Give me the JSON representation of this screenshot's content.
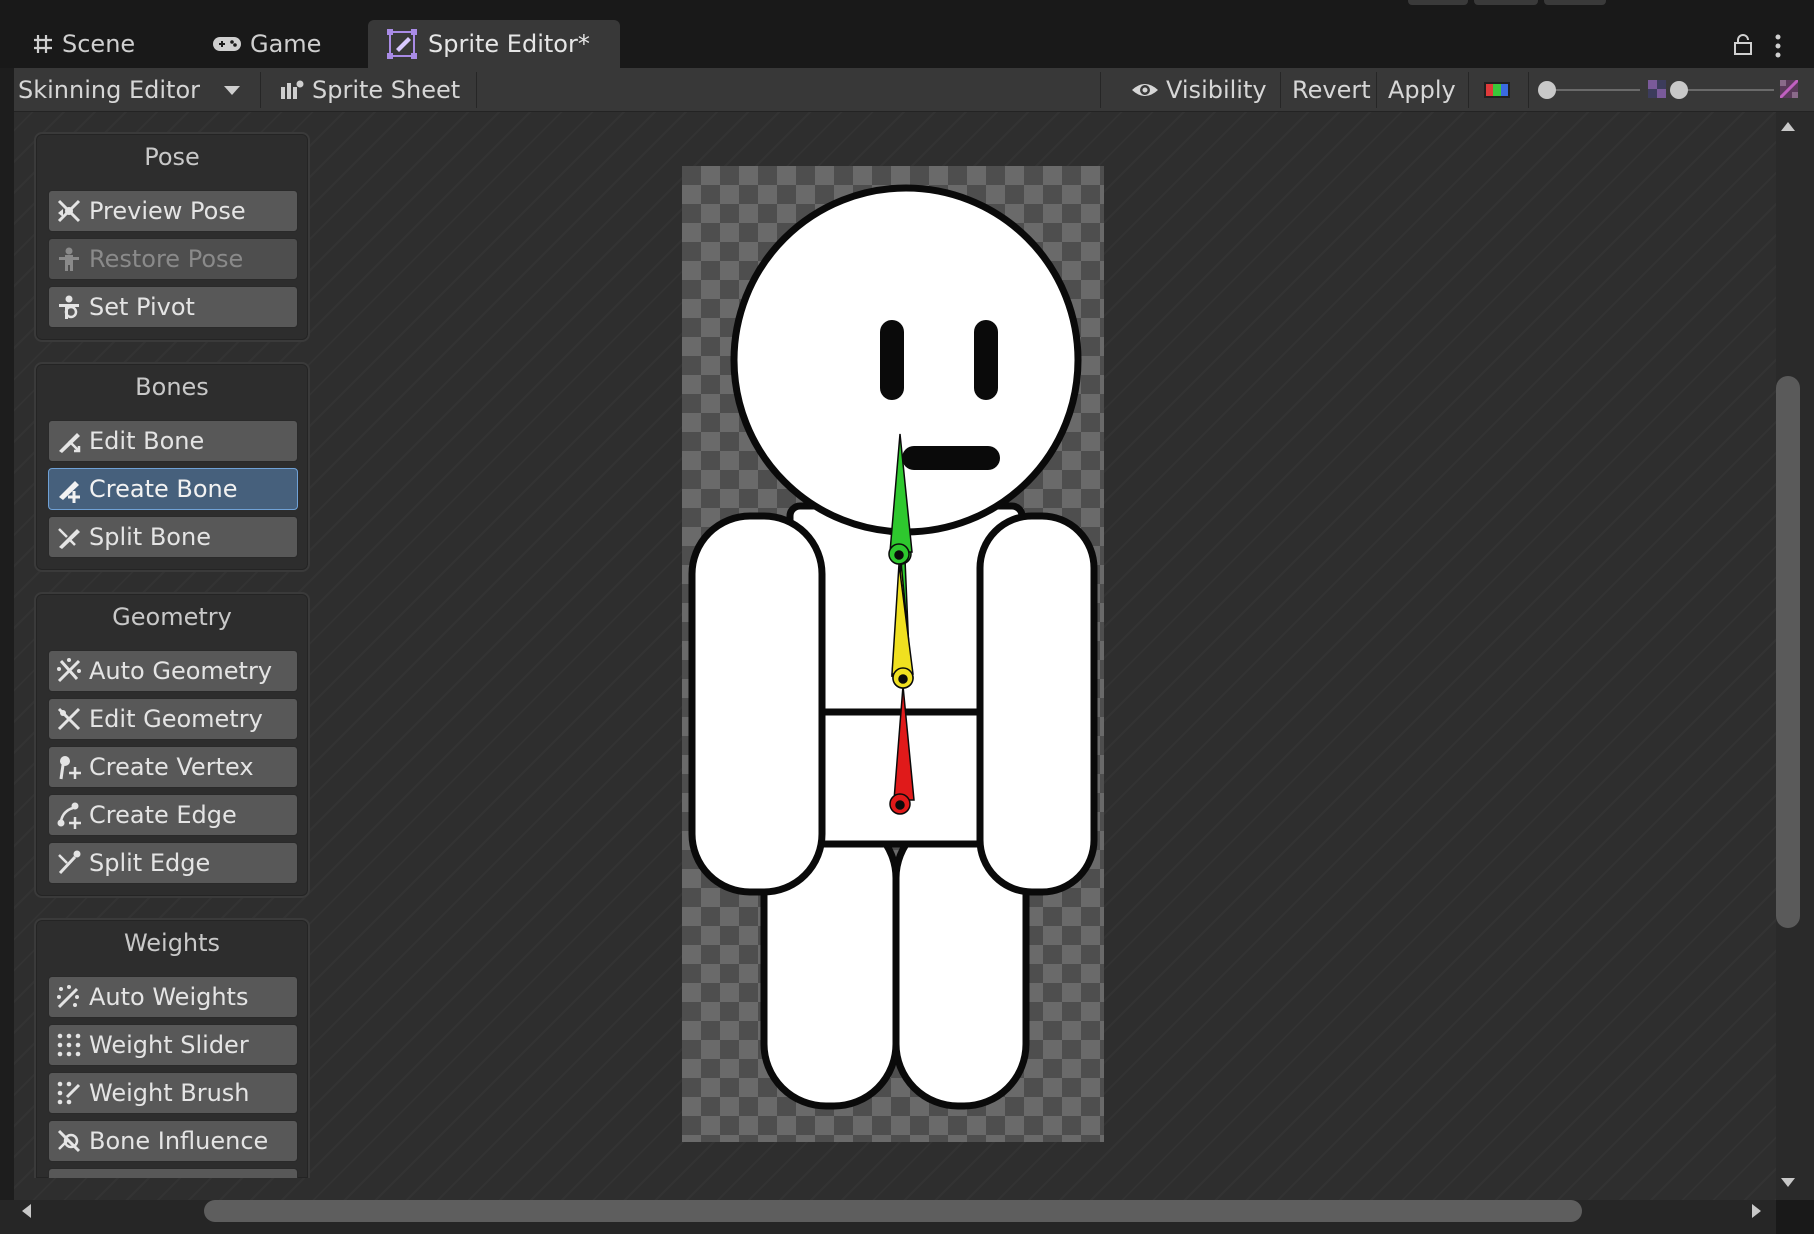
{
  "window": {
    "tabs": [
      {
        "label": "Scene",
        "icon": "grid-icon"
      },
      {
        "label": "Game",
        "icon": "gamepad-icon"
      },
      {
        "label": "Sprite Editor*",
        "icon": "sprite-editor-icon",
        "active": true
      }
    ]
  },
  "toolbar": {
    "mode_label": "Skinning Editor",
    "sprite_sheet_label": "Sprite Sheet",
    "visibility_label": "Visibility",
    "revert_label": "Revert",
    "apply_label": "Apply"
  },
  "panels": {
    "pose": {
      "title": "Pose",
      "buttons": [
        {
          "label": "Preview Pose",
          "icon": "preview-pose-icon"
        },
        {
          "label": "Restore Pose",
          "icon": "restore-pose-icon",
          "disabled": true
        },
        {
          "label": "Set Pivot",
          "icon": "set-pivot-icon"
        }
      ]
    },
    "bones": {
      "title": "Bones",
      "buttons": [
        {
          "label": "Edit Bone",
          "icon": "edit-bone-icon"
        },
        {
          "label": "Create Bone",
          "icon": "create-bone-icon",
          "selected": true
        },
        {
          "label": "Split Bone",
          "icon": "split-bone-icon"
        }
      ]
    },
    "geometry": {
      "title": "Geometry",
      "buttons": [
        {
          "label": "Auto Geometry",
          "icon": "auto-geometry-icon"
        },
        {
          "label": "Edit Geometry",
          "icon": "edit-geometry-icon"
        },
        {
          "label": "Create Vertex",
          "icon": "create-vertex-icon"
        },
        {
          "label": "Create Edge",
          "icon": "create-edge-icon"
        },
        {
          "label": "Split Edge",
          "icon": "split-edge-icon"
        }
      ]
    },
    "weights": {
      "title": "Weights",
      "buttons": [
        {
          "label": "Auto Weights",
          "icon": "auto-weights-icon"
        },
        {
          "label": "Weight Slider",
          "icon": "weight-slider-icon"
        },
        {
          "label": "Weight Brush",
          "icon": "weight-brush-icon"
        },
        {
          "label": "Bone Influence",
          "icon": "bone-influence-icon"
        }
      ]
    }
  },
  "colors": {
    "bone_top": "#2ec82e",
    "bone_middle": "#f0e020",
    "bone_bottom": "#e01a1a",
    "selected_button": "#46607c",
    "selected_border": "#6fa1d6"
  },
  "sliders": {
    "brush_size_level": 0.0,
    "alpha_level": 0.0
  }
}
